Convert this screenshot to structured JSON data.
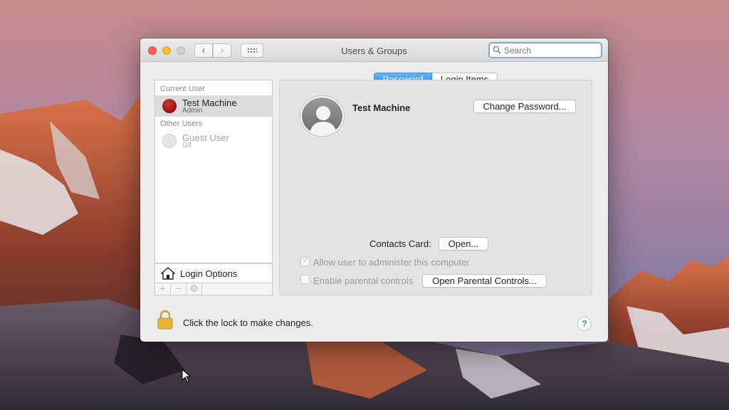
{
  "window": {
    "title": "Users & Groups"
  },
  "search": {
    "placeholder": "Search",
    "value": ""
  },
  "sidebar": {
    "current_user_heading": "Current User",
    "other_users_heading": "Other Users",
    "users": [
      {
        "name": "Test Machine",
        "role": "Admin",
        "selected": true,
        "avatar": "red-avatar"
      },
      {
        "name": "Guest User",
        "role": "Off",
        "selected": false,
        "avatar": "guest-avatar"
      }
    ],
    "login_options_label": "Login Options",
    "toolbar": {
      "add": "+",
      "remove": "−",
      "settings_icon": "gear-icon"
    }
  },
  "tabs": [
    {
      "label": "Password",
      "active": true
    },
    {
      "label": "Login Items",
      "active": false
    }
  ],
  "account": {
    "name": "Test Machine",
    "change_password_label": "Change Password..."
  },
  "contacts": {
    "label": "Contacts Card:",
    "open_label": "Open..."
  },
  "options": {
    "allow_admin_label": "Allow user to administer this computer",
    "allow_admin_checked": true,
    "parental_label": "Enable parental controls",
    "parental_checked": false,
    "open_parental_label": "Open Parental Controls..."
  },
  "footer": {
    "lock_text": "Click the lock to make changes.",
    "help_label": "?"
  },
  "colors": {
    "accent": "#1a82fb",
    "close": "#fc5f57",
    "minimize": "#fdbc2e"
  }
}
